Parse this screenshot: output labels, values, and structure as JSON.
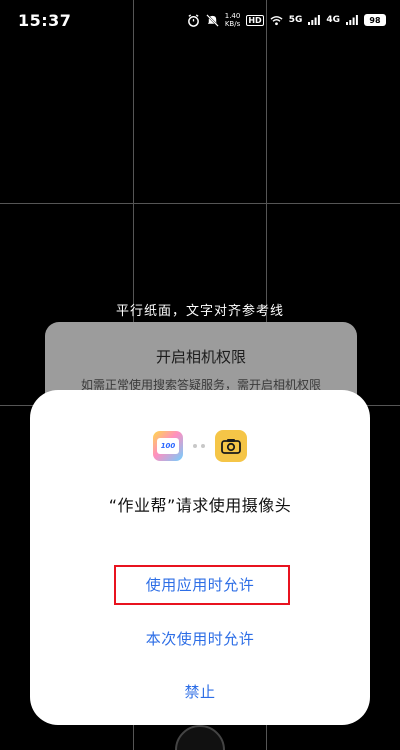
{
  "status_bar": {
    "time": "15:37",
    "net_speed_value": "1.40",
    "net_speed_unit": "KB/s",
    "hd_label": "HD",
    "signal_1": "5G",
    "signal_2": "4G",
    "battery": "98",
    "icons": [
      "alarm-icon",
      "mute-icon",
      "wifi-icon",
      "signal-icon"
    ]
  },
  "camera": {
    "guide_text": "平行纸面，文字对齐参考线"
  },
  "background_dialog": {
    "title": "开启相机权限",
    "text": "如需正常使用搜索答疑服务，需开启相机权限"
  },
  "permission_dialog": {
    "app_icon_text": "100",
    "title": "“作业帮”请求使用摄像头",
    "allow_while_using": "使用应用时允许",
    "allow_once": "本次使用时允许",
    "deny": "禁止",
    "accent_color": "#2d6ee6",
    "highlight_color": "#e8131f"
  }
}
